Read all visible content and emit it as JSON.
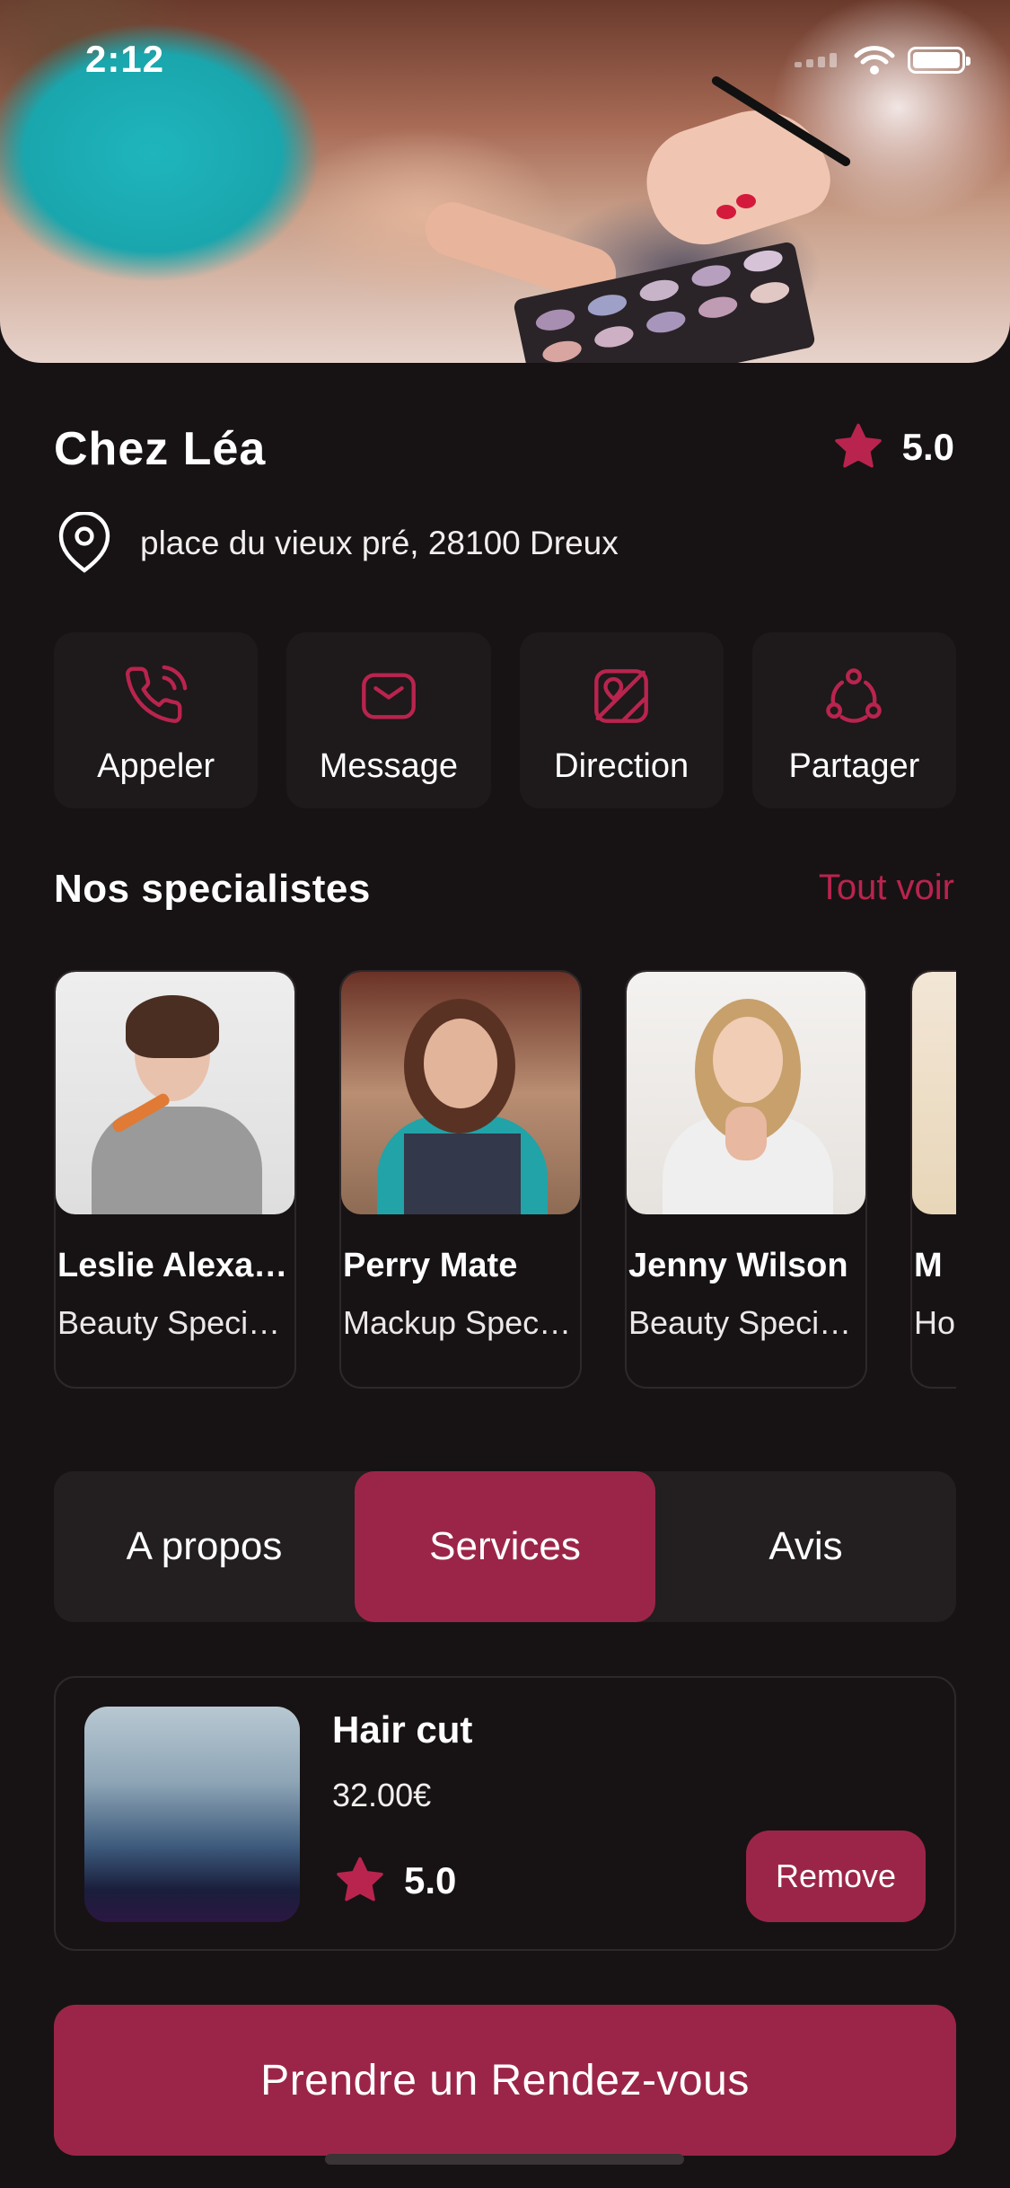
{
  "status_bar": {
    "time": "2:12"
  },
  "salon": {
    "name": "Chez Léa",
    "rating": "5.0",
    "address": "place du vieux pré, 28100 Dreux"
  },
  "actions": [
    {
      "label": "Appeler",
      "icon": "phone-icon"
    },
    {
      "label": "Message",
      "icon": "mail-icon"
    },
    {
      "label": "Direction",
      "icon": "map-icon"
    },
    {
      "label": "Partager",
      "icon": "share-icon"
    }
  ],
  "specialists_section": {
    "title": "Nos specialistes",
    "see_all": "Tout voir",
    "items": [
      {
        "name": "Leslie Alexander",
        "role": "Beauty Specialist"
      },
      {
        "name": "Perry Mate",
        "role": "Mackup Specialist"
      },
      {
        "name": "Jenny Wilson",
        "role": "Beauty Specialist"
      },
      {
        "name": "M",
        "role": "Ho"
      }
    ]
  },
  "tabs": [
    {
      "label": "A propos",
      "active": false
    },
    {
      "label": "Services",
      "active": true
    },
    {
      "label": "Avis",
      "active": false
    }
  ],
  "service": {
    "name": "Hair cut",
    "price": "32.00€",
    "rating": "5.0",
    "remove_label": "Remove"
  },
  "cta_label": "Prendre un Rendez-vous",
  "colors": {
    "accent": "#9b2548",
    "accent_text": "#b9244e",
    "background": "#171314",
    "card": "#1e191b"
  }
}
